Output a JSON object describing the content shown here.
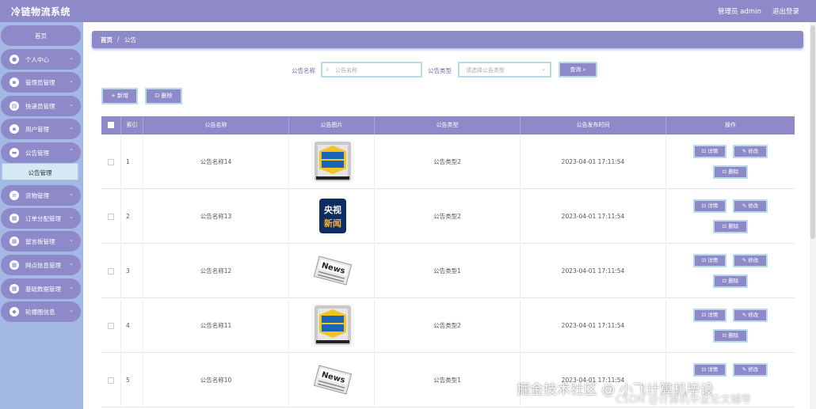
{
  "header": {
    "title": "冷链物流系统",
    "admin": "管理员 admin",
    "logout": "退出登录"
  },
  "sidebar": {
    "home": "首页",
    "items": [
      {
        "label": "个人中心",
        "icon": "user-icon"
      },
      {
        "label": "管理员管理",
        "icon": "briefcase-icon"
      },
      {
        "label": "快递员管理",
        "icon": "document-icon"
      },
      {
        "label": "用户管理",
        "icon": "users-icon"
      },
      {
        "label": "公告管理",
        "icon": "folder-icon"
      },
      {
        "label": "货物管理",
        "icon": "list-icon"
      },
      {
        "label": "订单分配管理",
        "icon": "grid-icon"
      },
      {
        "label": "留言板管理",
        "icon": "grid-icon"
      },
      {
        "label": "网点信息管理",
        "icon": "grid-icon"
      },
      {
        "label": "基础数据管理",
        "icon": "grid-icon"
      },
      {
        "label": "轮播图信息",
        "icon": "shield-icon"
      }
    ],
    "sub_active": "公告管理"
  },
  "breadcrumb": {
    "home": "首页",
    "separator": "/",
    "current": "公告"
  },
  "search": {
    "name_label": "公告名称",
    "name_placeholder": "公告名称",
    "type_label": "公告类型",
    "type_placeholder": "请选择公告类型",
    "query_button": "查询 ⌕"
  },
  "actions": {
    "add": "+ 新增",
    "delete": "⊡ 删除"
  },
  "table": {
    "columns": [
      "索引",
      "公告名称",
      "公告图片",
      "公告类型",
      "公告发布时间",
      "操作"
    ],
    "rows": [
      {
        "index": "1",
        "name": "公告名称14",
        "image": "news-badge",
        "type": "公告类型2",
        "time": "2023-04-01 17:11:54"
      },
      {
        "index": "2",
        "name": "公告名称13",
        "image": "cctv-news",
        "type": "公告类型2",
        "time": "2023-04-01 17:11:54"
      },
      {
        "index": "3",
        "name": "公告名称12",
        "image": "news-paper",
        "type": "公告类型1",
        "time": "2023-04-01 17:11:54"
      },
      {
        "index": "4",
        "name": "公告名称11",
        "image": "news-badge",
        "type": "公告类型2",
        "time": "2023-04-01 17:11:54"
      },
      {
        "index": "5",
        "name": "公告名称10",
        "image": "news-paper",
        "type": "公告类型1",
        "time": "2023-04-01 17:11:54"
      }
    ],
    "op_detail": "⊡ 详情",
    "op_edit": "✎ 修改",
    "op_delete": "⊡ 删除"
  },
  "watermark": {
    "line1": "掘金技术社区 @ 小飞计算机毕设",
    "line2": "CSDN @计算机毕业论文辅导"
  },
  "colors": {
    "accent": "#8e89c8",
    "sidebar": "#a4b8e6",
    "border": "#b7dbe9"
  }
}
